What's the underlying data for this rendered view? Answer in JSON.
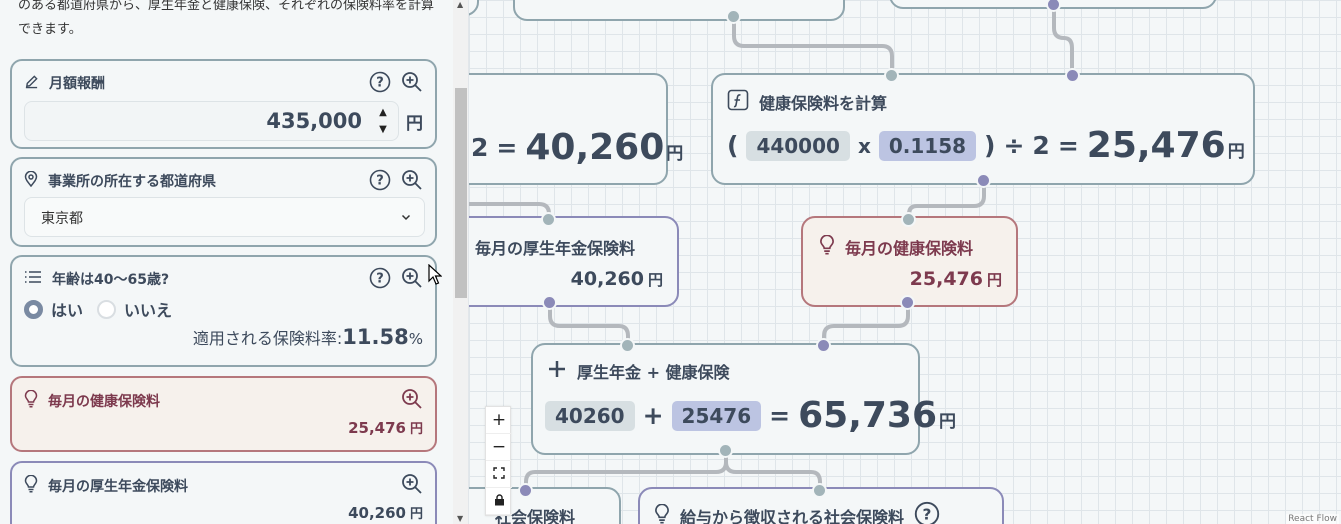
{
  "sidebar": {
    "intro": "のある都道府県から、厚生年金と健康保険、それぞれの保険料率を計算できます。",
    "monthly_pay": {
      "label": "月額報酬",
      "value": "435,000",
      "unit": "円"
    },
    "prefecture": {
      "label": "事業所の所在する都道府県",
      "selected": "東京都"
    },
    "age": {
      "label": "年齢は40〜65歳?",
      "options": [
        "はい",
        "いいえ"
      ],
      "selected": "はい",
      "rate_label": "適用される保険料率:",
      "rate_value": "11.58",
      "rate_unit": "%"
    },
    "health_card": {
      "label": "毎月の健康保険料",
      "value": "25,476",
      "unit": "円"
    },
    "pension_card": {
      "label": "毎月の厚生年金保険料",
      "value": "40,260",
      "unit": "円"
    }
  },
  "canvas": {
    "pension_calc": {
      "tail_num": "2",
      "eq": "=",
      "result": "40,260",
      "unit": "円"
    },
    "health_calc": {
      "title": "健康保険料を計算",
      "open": "(",
      "a": "440000",
      "times": "x",
      "b": "0.1158",
      "close": ")",
      "div": "÷",
      "two": "2",
      "eq": "=",
      "result": "25,476",
      "unit": "円"
    },
    "pension_node": {
      "title": "毎月の厚生年金保険料",
      "value": "40,260",
      "unit": "円"
    },
    "health_node": {
      "title": "毎月の健康保険料",
      "value": "25,476",
      "unit": "円"
    },
    "sum_node": {
      "title": "厚生年金 + 健康保険",
      "a": "40260",
      "plus": "+",
      "b": "25476",
      "eq": "=",
      "result": "65,736",
      "unit": "円"
    },
    "bottom_left": {
      "title": "社会保険料"
    },
    "bottom_right": {
      "title": "給与から徴収される社会保険料"
    },
    "controls": {
      "zoom_in": "+",
      "zoom_out": "−"
    },
    "attribution": "React Flow"
  },
  "colors": {
    "node_border": "#8fa5ad",
    "pink_border": "#b5777c",
    "purple_border": "#8b8ab8",
    "text": "#3d4a5c",
    "pink_text": "#7d3a4e"
  }
}
